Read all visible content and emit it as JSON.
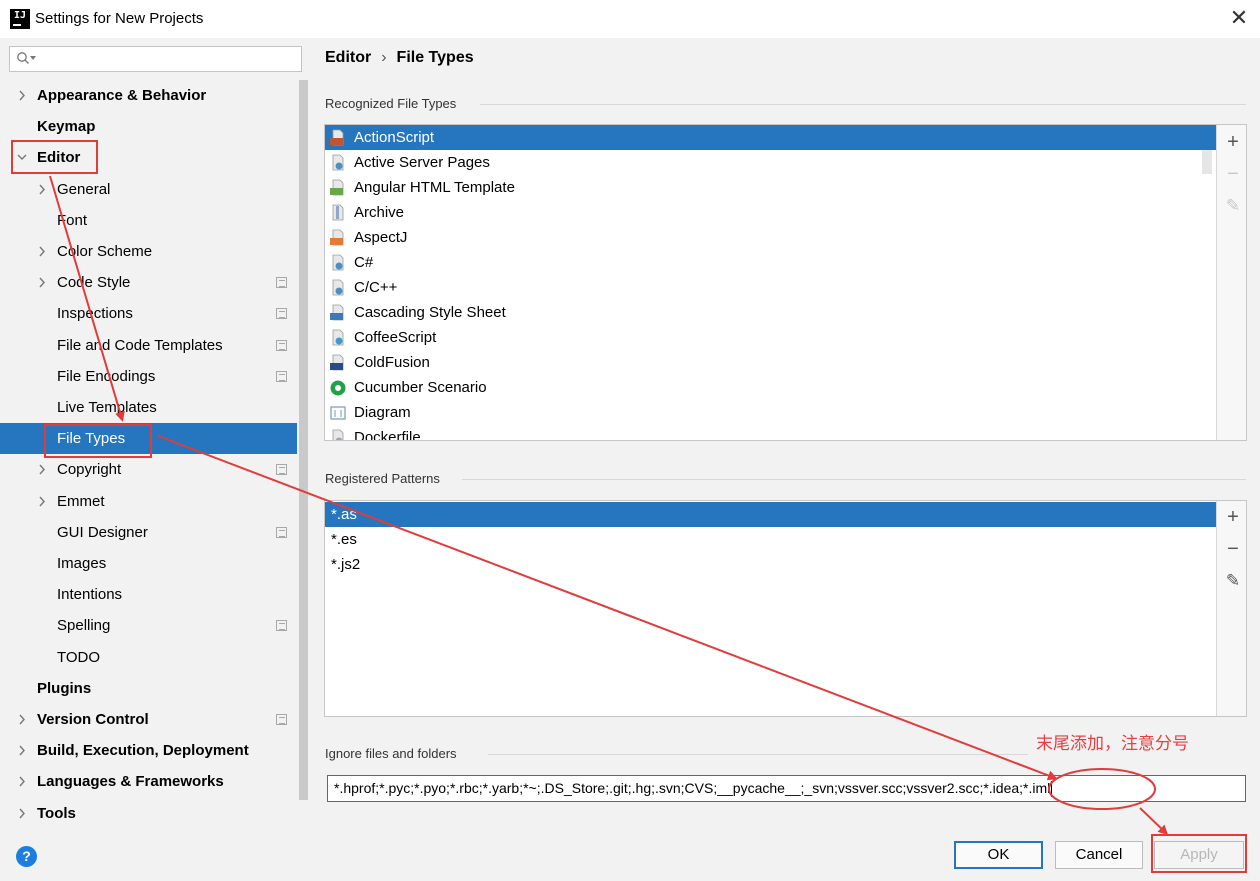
{
  "window": {
    "title": "Settings for New Projects",
    "close_glyph": "✕"
  },
  "search": {
    "placeholder": ""
  },
  "sidebar": {
    "items": [
      {
        "label": "Appearance & Behavior",
        "level": 0,
        "expander": "collapsed",
        "bold": true
      },
      {
        "label": "Keymap",
        "level": 0,
        "expander": "none",
        "bold": true
      },
      {
        "label": "Editor",
        "level": 0,
        "expander": "expanded",
        "bold": true
      },
      {
        "label": "General",
        "level": 1,
        "expander": "collapsed"
      },
      {
        "label": "Font",
        "level": 1,
        "expander": "none"
      },
      {
        "label": "Color Scheme",
        "level": 1,
        "expander": "collapsed"
      },
      {
        "label": "Code Style",
        "level": 1,
        "expander": "collapsed",
        "project_icon": true
      },
      {
        "label": "Inspections",
        "level": 1,
        "expander": "none",
        "project_icon": true
      },
      {
        "label": "File and Code Templates",
        "level": 1,
        "expander": "none",
        "project_icon": true
      },
      {
        "label": "File Encodings",
        "level": 1,
        "expander": "none",
        "project_icon": true
      },
      {
        "label": "Live Templates",
        "level": 1,
        "expander": "none"
      },
      {
        "label": "File Types",
        "level": 1,
        "expander": "none",
        "selected": true
      },
      {
        "label": "Copyright",
        "level": 1,
        "expander": "collapsed",
        "project_icon": true
      },
      {
        "label": "Emmet",
        "level": 1,
        "expander": "collapsed"
      },
      {
        "label": "GUI Designer",
        "level": 1,
        "expander": "none",
        "project_icon": true
      },
      {
        "label": "Images",
        "level": 1,
        "expander": "none"
      },
      {
        "label": "Intentions",
        "level": 1,
        "expander": "none"
      },
      {
        "label": "Spelling",
        "level": 1,
        "expander": "none",
        "project_icon": true
      },
      {
        "label": "TODO",
        "level": 1,
        "expander": "none"
      },
      {
        "label": "Plugins",
        "level": 0,
        "expander": "none",
        "bold": true
      },
      {
        "label": "Version Control",
        "level": 0,
        "expander": "collapsed",
        "bold": true,
        "project_icon": true
      },
      {
        "label": "Build, Execution, Deployment",
        "level": 0,
        "expander": "collapsed",
        "bold": true
      },
      {
        "label": "Languages & Frameworks",
        "level": 0,
        "expander": "collapsed",
        "bold": true
      },
      {
        "label": "Tools",
        "level": 0,
        "expander": "collapsed",
        "bold": true
      }
    ]
  },
  "breadcrumb": {
    "parent": "Editor",
    "separator": "›",
    "current": "File Types"
  },
  "recognized": {
    "title": "Recognized File Types",
    "items": [
      {
        "label": "ActionScript",
        "icon": "actionscript-icon",
        "badge": "AS",
        "color": "#c0562f",
        "selected": true
      },
      {
        "label": "Active Server Pages",
        "icon": "asp-file-icon",
        "color": "#4a90c8"
      },
      {
        "label": "Angular HTML Template",
        "icon": "angular-html-icon",
        "badge": "H",
        "color": "#67a84a"
      },
      {
        "label": "Archive",
        "icon": "archive-icon",
        "color": "#8fa8c8"
      },
      {
        "label": "AspectJ",
        "icon": "aspectj-icon",
        "badge": "AJ",
        "color": "#e07b39"
      },
      {
        "label": "C#",
        "icon": "csharp-file-icon",
        "color": "#4a90c8"
      },
      {
        "label": "C/C++",
        "icon": "cpp-file-icon",
        "color": "#4a90c8"
      },
      {
        "label": "Cascading Style Sheet",
        "icon": "css-icon",
        "badge": "CSS",
        "color": "#3a7ab8"
      },
      {
        "label": "CoffeeScript",
        "icon": "coffeescript-icon",
        "color": "#3d9ad8"
      },
      {
        "label": "ColdFusion",
        "icon": "coldfusion-icon",
        "badge": "Cf",
        "color": "#2a4a8a"
      },
      {
        "label": "Cucumber Scenario",
        "icon": "cucumber-icon",
        "color": "#23a04a"
      },
      {
        "label": "Diagram",
        "icon": "diagram-icon",
        "color": "#7a9ab8"
      },
      {
        "label": "Dockerfile",
        "icon": "dockerfile-icon",
        "color": "#9aa8b8"
      }
    ]
  },
  "patterns": {
    "title": "Registered Patterns",
    "items": [
      {
        "label": "*.as",
        "selected": true
      },
      {
        "label": "*.es"
      },
      {
        "label": "*.js2"
      }
    ]
  },
  "toolbar": {
    "add": "+",
    "remove": "−",
    "edit": "✎"
  },
  "ignore": {
    "title": "Ignore files and folders",
    "value": "*.hprof;*.pyc;*.pyo;*.rbc;*.yarb;*~;.DS_Store;.git;.hg;.svn;CVS;__pycache__;_svn;vssver.scc;vssver2.scc;*.idea;*.iml"
  },
  "annotation": {
    "note": "末尾添加，注意分号",
    "color": "#e23b3b"
  },
  "buttons": {
    "ok": "OK",
    "cancel": "Cancel",
    "apply": "Apply",
    "help": "?"
  },
  "colors": {
    "selection": "#2675bf",
    "accent": "#2675bf"
  }
}
